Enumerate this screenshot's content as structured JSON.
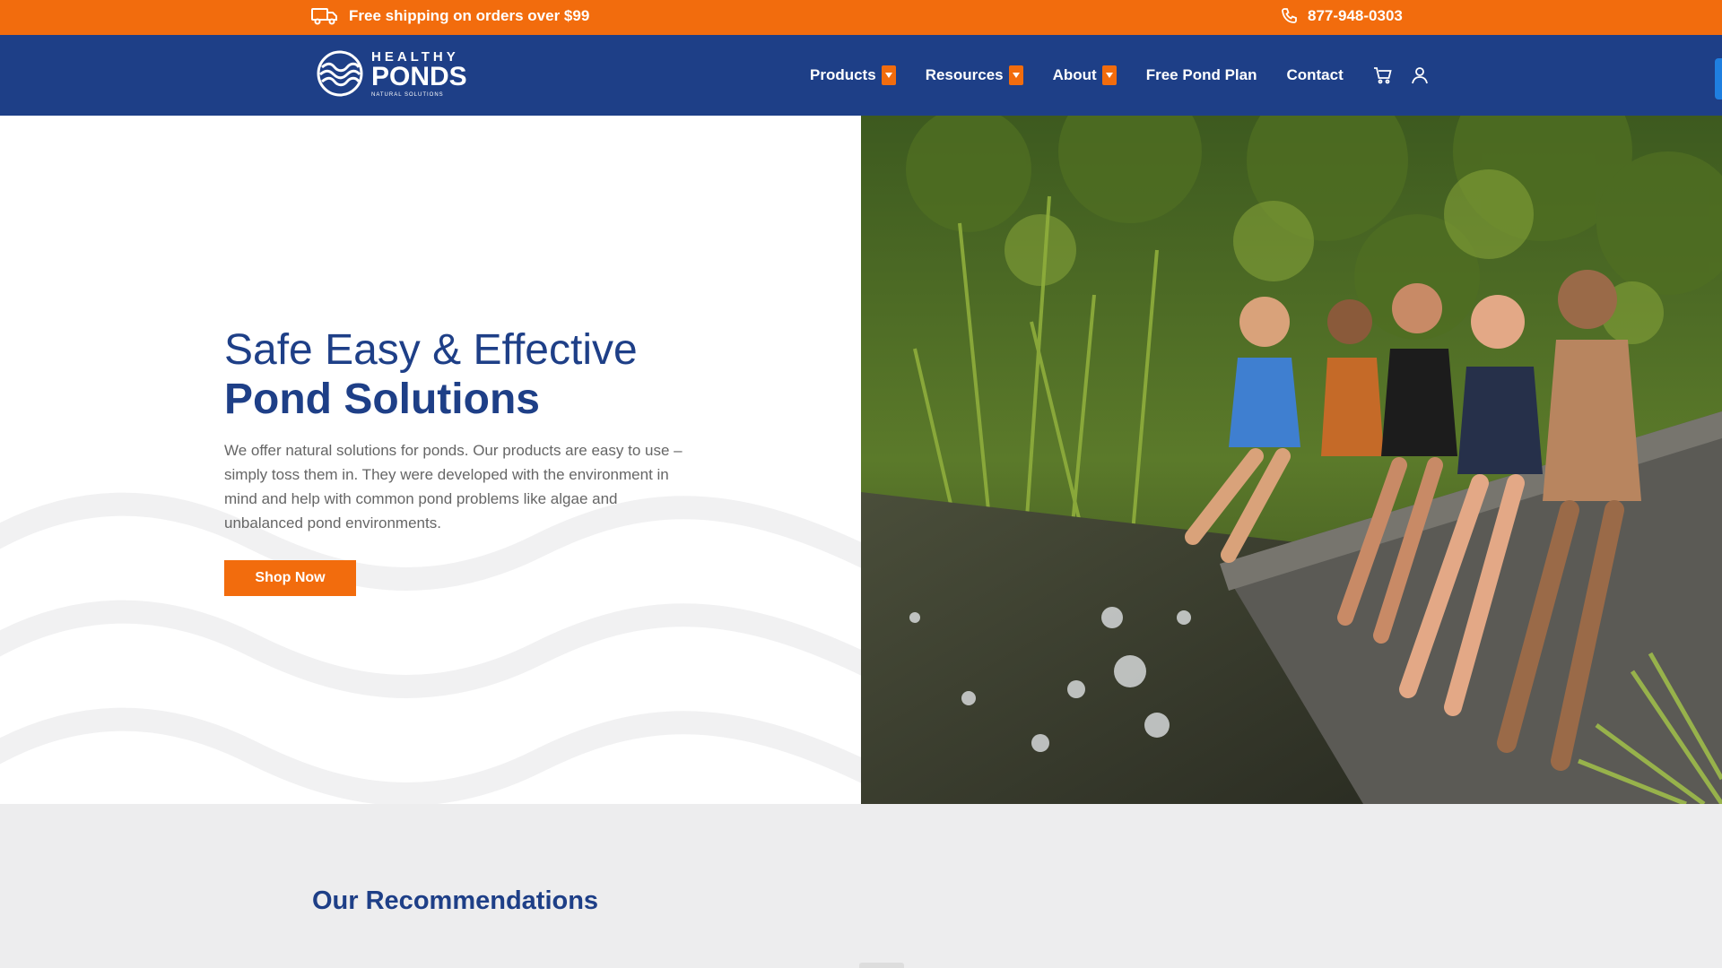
{
  "topbar": {
    "shipping_text": "Free shipping on orders over $99",
    "phone": "877-948-0303",
    "icons": [
      "truck-icon",
      "phone-icon"
    ]
  },
  "nav": {
    "logo": {
      "top": "HEALTHY",
      "main": "PONDS",
      "sub": "NATURAL SOLUTIONS"
    },
    "menu": [
      {
        "label": "Products",
        "dropdown": true
      },
      {
        "label": "Resources",
        "dropdown": true
      },
      {
        "label": "About",
        "dropdown": true
      },
      {
        "label": "Free Pond Plan",
        "dropdown": false
      },
      {
        "label": "Contact",
        "dropdown": false
      }
    ],
    "icons": [
      "cart-icon",
      "user-icon"
    ]
  },
  "hero": {
    "title_line1": "Safe Easy & Effective",
    "title_line2": "Pond Solutions",
    "description": "We offer natural solutions for ponds. Our products are easy to use – simply toss them in.  They were developed with the environment in mind and help with common pond problems like algae and unbalanced pond environments.",
    "cta_label": "Shop Now"
  },
  "recommendations": {
    "title": "Our Recommendations"
  },
  "colors": {
    "orange": "#f26c0d",
    "navy": "#1e3f87",
    "light_gray": "#ededee"
  }
}
